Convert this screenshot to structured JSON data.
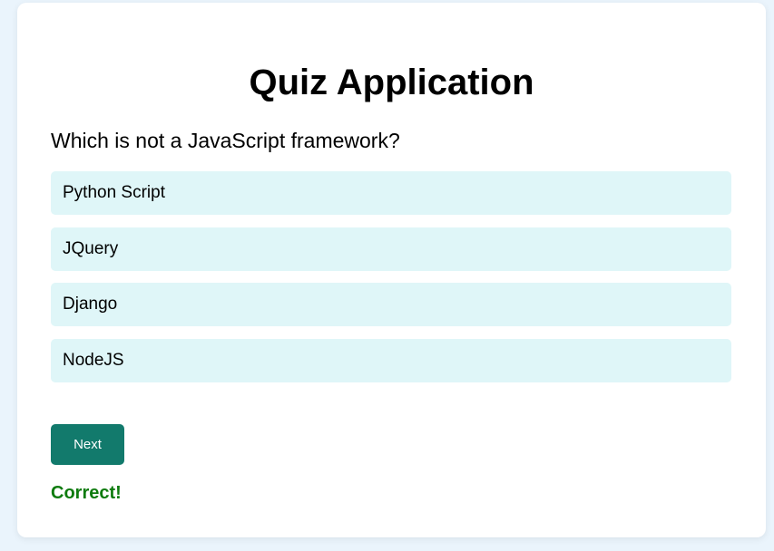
{
  "app": {
    "title": "Quiz Application"
  },
  "quiz": {
    "question": "Which is not a JavaScript framework?",
    "options": [
      {
        "label": "Python Script"
      },
      {
        "label": "JQuery"
      },
      {
        "label": "Django"
      },
      {
        "label": "NodeJS"
      }
    ],
    "next_label": "Next",
    "result_text": "Correct!"
  },
  "colors": {
    "page_background": "#eaf4fc",
    "option_background": "#dff6f8",
    "next_button": "#127a6c",
    "result_correct": "#0e7b0e"
  }
}
